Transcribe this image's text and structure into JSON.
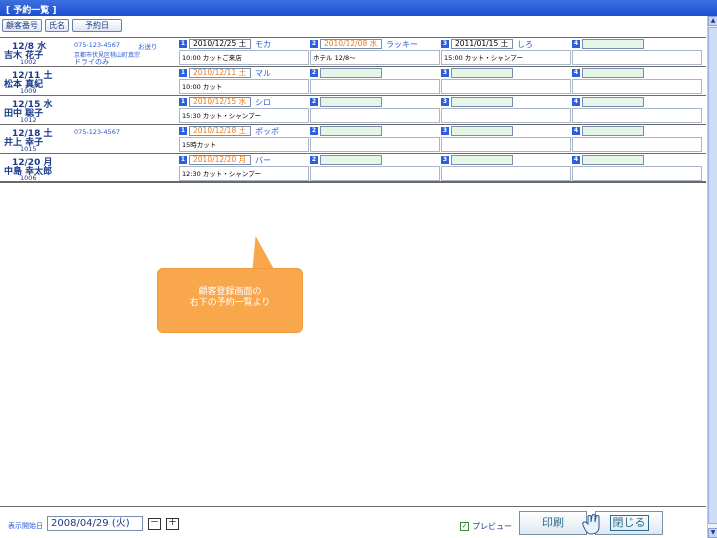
{
  "window": {
    "title": "[ 予約一覧 ]"
  },
  "sort_buttons": [
    {
      "label": "顧客番号"
    },
    {
      "label": "氏名"
    },
    {
      "label": "予約日"
    }
  ],
  "rows": [
    {
      "date": "12/8 水",
      "name": "吉木 花子",
      "customer_no": "1002",
      "phone": "075-123-4567",
      "destination": "お送り",
      "address": "京都市伏見区桃山町真宗",
      "memo": "ドライのみ",
      "slots": [
        {
          "num": "1",
          "date": "2010/12/25 土",
          "date_style": "filled",
          "staff": "モカ",
          "detail": "10:00 カットご来店"
        },
        {
          "num": "2",
          "date": "2010/12/08 水",
          "date_style": "orange",
          "staff": "ラッキー",
          "detail": "ホテル 12/8～"
        },
        {
          "num": "3",
          "date": "2011/01/15 土",
          "date_style": "filled",
          "staff": "しろ",
          "detail": "15:00 カット・シャンプー"
        },
        {
          "num": "4",
          "date": "",
          "date_style": "empty",
          "staff": "",
          "detail": ""
        }
      ]
    },
    {
      "date": "12/11 土",
      "name": "松本 真紀",
      "customer_no": "1009",
      "phone": "",
      "destination": "",
      "address": "",
      "memo": "",
      "slots": [
        {
          "num": "1",
          "date": "2010/12/11 土",
          "date_style": "orange",
          "staff": "マル",
          "detail": "10:00 カット"
        },
        {
          "num": "2",
          "date": "",
          "date_style": "empty",
          "staff": "",
          "detail": ""
        },
        {
          "num": "3",
          "date": "",
          "date_style": "empty",
          "staff": "",
          "detail": ""
        },
        {
          "num": "4",
          "date": "",
          "date_style": "empty",
          "staff": "",
          "detail": ""
        }
      ]
    },
    {
      "date": "12/15 水",
      "name": "田中 聡子",
      "customer_no": "1012",
      "phone": "",
      "destination": "",
      "address": "",
      "memo": "",
      "slots": [
        {
          "num": "1",
          "date": "2010/12/15 水",
          "date_style": "orange",
          "staff": "シロ",
          "detail": "15:30 カット・シャンプー"
        },
        {
          "num": "2",
          "date": "",
          "date_style": "empty",
          "staff": "",
          "detail": ""
        },
        {
          "num": "3",
          "date": "",
          "date_style": "empty",
          "staff": "",
          "detail": ""
        },
        {
          "num": "4",
          "date": "",
          "date_style": "empty",
          "staff": "",
          "detail": ""
        }
      ]
    },
    {
      "date": "12/18 土",
      "name": "井上 幸子",
      "customer_no": "1015",
      "phone": "075-123-4567",
      "destination": "",
      "address": "",
      "memo": "",
      "slots": [
        {
          "num": "1",
          "date": "2010/12/18 土",
          "date_style": "orange",
          "staff": "ポッポ",
          "detail": "15時カット"
        },
        {
          "num": "2",
          "date": "",
          "date_style": "empty",
          "staff": "",
          "detail": ""
        },
        {
          "num": "3",
          "date": "",
          "date_style": "empty",
          "staff": "",
          "detail": ""
        },
        {
          "num": "4",
          "date": "",
          "date_style": "empty",
          "staff": "",
          "detail": ""
        }
      ]
    },
    {
      "date": "12/20 月",
      "name": "中島 幸太郎",
      "customer_no": "1006",
      "phone": "",
      "destination": "",
      "address": "",
      "memo": "",
      "slots": [
        {
          "num": "1",
          "date": "2010/12/20 月",
          "date_style": "orange",
          "staff": "バー",
          "detail": "12:30 カット・シャンプー"
        },
        {
          "num": "2",
          "date": "",
          "date_style": "empty",
          "staff": "",
          "detail": ""
        },
        {
          "num": "3",
          "date": "",
          "date_style": "empty",
          "staff": "",
          "detail": ""
        },
        {
          "num": "4",
          "date": "",
          "date_style": "empty",
          "staff": "",
          "detail": ""
        }
      ]
    }
  ],
  "callout": {
    "line1": "顧客登録画面の",
    "line2": "右下の予約一覧より"
  },
  "footer": {
    "start_label": "表示開始日",
    "start_date": "2008/04/29 (火)",
    "minus": "－",
    "plus": "＋",
    "preview_label": "プレビュー",
    "preview_check": "✓",
    "print_label": "印刷",
    "close_label": "閉じる"
  },
  "scrollbar": {
    "up": "▲",
    "down": "▼"
  },
  "colors": {
    "accent": "#2c5fe0",
    "title_bar": "#1c4fd0",
    "callout": "#f9a74d",
    "date_highlight": "#e87a1a"
  }
}
